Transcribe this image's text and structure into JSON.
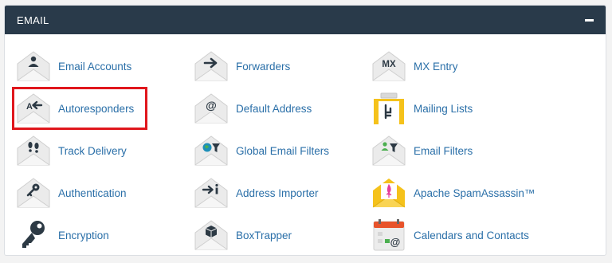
{
  "section": {
    "title": "EMAIL",
    "collapse_icon": "minus-icon"
  },
  "colors": {
    "header_bg": "#293a4a",
    "link": "#2a6fa8",
    "highlight": "#e0171d",
    "icon_dark": "#2c3944",
    "envelope": "#e8e8e8",
    "yellow": "#f5c21b"
  },
  "items": [
    {
      "label": "Email Accounts",
      "icon": "email-accounts-icon"
    },
    {
      "label": "Forwarders",
      "icon": "forwarders-icon"
    },
    {
      "label": "MX Entry",
      "icon": "mx-entry-icon"
    },
    {
      "label": "Autoresponders",
      "icon": "autoresponders-icon",
      "highlighted": true
    },
    {
      "label": "Default Address",
      "icon": "default-address-icon"
    },
    {
      "label": "Mailing Lists",
      "icon": "mailing-lists-icon"
    },
    {
      "label": "Track Delivery",
      "icon": "track-delivery-icon"
    },
    {
      "label": "Global Email Filters",
      "icon": "global-email-filters-icon"
    },
    {
      "label": "Email Filters",
      "icon": "email-filters-icon"
    },
    {
      "label": "Authentication",
      "icon": "authentication-icon"
    },
    {
      "label": "Address Importer",
      "icon": "address-importer-icon"
    },
    {
      "label": "Apache SpamAssassin™",
      "icon": "spamassassin-icon"
    },
    {
      "label": "Encryption",
      "icon": "encryption-icon"
    },
    {
      "label": "BoxTrapper",
      "icon": "boxtrapper-icon"
    },
    {
      "label": "Calendars and Contacts",
      "icon": "calendars-contacts-icon"
    }
  ]
}
